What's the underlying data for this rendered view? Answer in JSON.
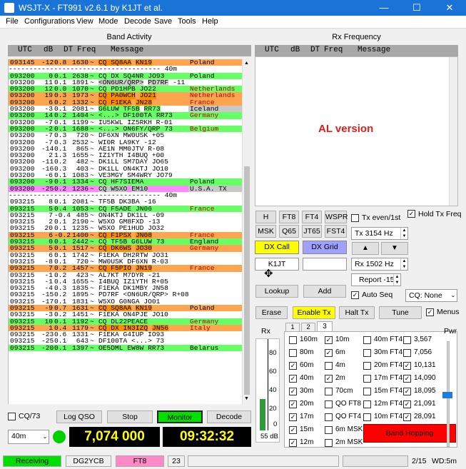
{
  "window": {
    "title": "WSJT-X - FT991  v2.6.1  by K1JT et al."
  },
  "menu": [
    "File",
    "Configurations",
    "View",
    "Mode",
    "Decode",
    "Save",
    "Tools",
    "Help"
  ],
  "band_activity": {
    "title": "Band Activity",
    "headers": [
      "UTC",
      "dB",
      "DT",
      "Freq",
      "Message"
    ],
    "rows": [
      {
        "u": "093145",
        "d": "-12",
        "t": "0.8",
        "f": "1630",
        "m": "CQ SQ8AA",
        "g": "KN19",
        "c": "Poland",
        "bg": "#ffa550",
        "hl": "#ff8c00",
        "cc": "#000"
      },
      {
        "sep": true,
        "text": "------------------------------------- 40m"
      },
      {
        "u": "093200",
        "d": "0",
        "t": "0.1",
        "f": "2638",
        "m": "CQ DX SQ4NR",
        "g": "JO93",
        "c": "Poland",
        "bg": "#66ff66",
        "hl": "#66ff66",
        "cc": "#000"
      },
      {
        "u": "093200",
        "d": "11",
        "t": "0.1",
        "f": "1891",
        "m": "<ON6UR/QRP>",
        "g": "PD7RF",
        "x": "-11",
        "bg": "#fff",
        "hl": "#d0d0d0",
        "cc": "#000"
      },
      {
        "u": "093200",
        "d": "12",
        "t": "0.0",
        "f": "1070",
        "m": "CQ PD1HPB",
        "g": "JO22",
        "c": "Netherlands",
        "bg": "#66ff66",
        "hl": "#66ff66",
        "cc": "#b00"
      },
      {
        "u": "093200",
        "d": "19",
        "t": "0.3",
        "f": "1973",
        "m": "CQ PA0WCH",
        "g": "JO21",
        "c": "Netherlands",
        "bg": "#ffa550",
        "hl": "#ff8c00",
        "cc": "#b00"
      },
      {
        "u": "093200",
        "d": "6",
        "t": "0.2",
        "f": "1332",
        "m": "CQ F1EKA",
        "g": "JN28",
        "c": "France",
        "bg": "#ffa550",
        "hl": "#ff8c00",
        "cc": "#b00"
      },
      {
        "u": "093200",
        "d": "-3",
        "t": "0.1",
        "f": "2081",
        "m": "G6LUW TF5B",
        "g": "RR73",
        "c": "Iceland",
        "bg": "#fff",
        "hl": "#66ff66",
        "cc": "#000",
        "cb": "#c8c8c8"
      },
      {
        "u": "093200",
        "d": "14",
        "t": "0.2",
        "f": "1404",
        "m": "<...> DF100TA",
        "g": "RR73",
        "c": "Germany",
        "bg": "#66ff66",
        "hl": "#66ff66",
        "cc": "#b00"
      },
      {
        "u": "093200",
        "d": "-7",
        "t": "0.1",
        "f": "1199",
        "m": "IU5KWL IZ5RKH R-01",
        "bg": "#fff"
      },
      {
        "u": "093200",
        "d": "-2",
        "t": "0.1",
        "f": "1688",
        "m": "<...> ON6FY/QRP",
        "g": "73",
        "c": "Belgium",
        "bg": "#66ff66",
        "hl": "#66ff66",
        "cc": "#b00"
      },
      {
        "u": "093200",
        "d": "-7",
        "t": "0.3",
        "f": "720",
        "m": "DF6XN MW0USK +05",
        "bg": "#fff"
      },
      {
        "u": "093200",
        "d": "-7",
        "t": "0.3",
        "f": "2532",
        "m": "WI0R LA9KY -12",
        "bg": "#fff"
      },
      {
        "u": "093200",
        "d": "-14",
        "t": "0.1",
        "f": "865",
        "m": "AE1N MM0JTV R-08",
        "bg": "#fff"
      },
      {
        "u": "093200",
        "d": "2",
        "t": "1.3",
        "f": "1655",
        "m": "IZ1YTH I4BUQ +00",
        "bg": "#fff"
      },
      {
        "u": "093200",
        "d": "-11",
        "t": "0.2",
        "f": "482",
        "m": "DK1LL SM7DAY JO65",
        "bg": "#fff"
      },
      {
        "u": "093200",
        "d": "-16",
        "t": "0.3",
        "f": "403",
        "m": "DK1LL ON4KTJ JO10",
        "bg": "#fff"
      },
      {
        "u": "093200",
        "d": "-6",
        "t": "0.1",
        "f": "1083",
        "m": "VE3MGY SM4WRY JO79",
        "bg": "#fff"
      },
      {
        "u": "093200",
        "d": "-9",
        "t": "0.1",
        "f": "1334",
        "m": "CQ HF7SIEMA",
        "c": "Poland",
        "bg": "#66ff66",
        "hl": "#66ff66",
        "cc": "#000"
      },
      {
        "u": "093200",
        "d": "-25",
        "t": "0.2",
        "f": "1236",
        "m": "CQ W5XO",
        "g": "EM10",
        "c": "U.S.A. TX",
        "bg": "#ff88ff",
        "hl": "#c8c8c8",
        "cc": "#000",
        "cb": "#c8c8c8"
      },
      {
        "sep": true,
        "text": "------------------------------------- 40m"
      },
      {
        "u": "093215",
        "d": "8",
        "t": "0.1",
        "f": "2081",
        "m": "TF5B DK3BA -16",
        "bg": "#fff"
      },
      {
        "u": "093215",
        "d": "5",
        "t": "0.4",
        "f": "1053",
        "m": "CQ F5ADE",
        "g": "JN06",
        "c": "France",
        "bg": "#66ff66",
        "hl": "#66ff66",
        "cc": "#b00"
      },
      {
        "u": "093215",
        "d": "7",
        "t": "-0.4",
        "f": "485",
        "m": "ON4KTJ DK1LL -09",
        "bg": "#fff"
      },
      {
        "u": "093215",
        "d": "2",
        "t": "0.1",
        "f": "2190",
        "m": "W5XO GM8FXD -13",
        "bg": "#fff"
      },
      {
        "u": "093215",
        "d": "20",
        "t": "0.1",
        "f": "1235",
        "m": "W5XO PE1HUD JO32",
        "bg": "#fff"
      },
      {
        "u": "093215",
        "d": "6",
        "t": "-0.2",
        "f": "1400",
        "m": "CQ F1PSX",
        "g": "JN08",
        "c": "France",
        "bg": "#ffa550",
        "hl": "#ff8c00",
        "cc": "#b00"
      },
      {
        "u": "093215",
        "d": "0",
        "t": "0.1",
        "f": "2442",
        "m": "CQ TF5B G6LUW",
        "g": "73",
        "c": "England",
        "bg": "#66ff66",
        "hl": "#66ff66",
        "cc": "#000"
      },
      {
        "u": "093215",
        "d": "5",
        "t": "0.1",
        "f": "1517",
        "m": "CQ DK6WS",
        "g": "JO30",
        "c": "Germany",
        "bg": "#ffa550",
        "hl": "#ff8c00",
        "cc": "#b00"
      },
      {
        "u": "093215",
        "d": "6",
        "t": "0.1",
        "f": "1742",
        "m": "F1EKA DH2RTW JO31",
        "bg": "#fff"
      },
      {
        "u": "093215",
        "d": "-8",
        "t": "0.1",
        "f": "720",
        "m": "MW0USK DF6XN R-03",
        "bg": "#fff"
      },
      {
        "u": "093215",
        "d": "7",
        "t": "0.2",
        "f": "1457",
        "m": "CQ F5PIO",
        "g": "JN19",
        "c": "France",
        "bg": "#ffa550",
        "hl": "#ff8c00",
        "cc": "#b00"
      },
      {
        "u": "093215",
        "d": "-1",
        "t": "0.2",
        "f": "423",
        "m": "AL7KT M7DYR -21",
        "bg": "#fff"
      },
      {
        "u": "093215",
        "d": "-1",
        "t": "0.4",
        "f": "1655",
        "m": "I4BUQ IZ1YTH R+05",
        "bg": "#fff"
      },
      {
        "u": "093215",
        "d": "-4",
        "t": "0.3",
        "f": "1835",
        "m": "F1EKA DK1MBY JN58",
        "bg": "#fff"
      },
      {
        "u": "093215",
        "d": "-15",
        "t": "0.2",
        "f": "1895",
        "m": "PD7RF <ON6UR/QRP> R+08",
        "bg": "#fff"
      },
      {
        "u": "093215",
        "d": "-17",
        "t": "0.1",
        "f": "1831",
        "m": "W5XO G0NGA JO01",
        "bg": "#fff"
      },
      {
        "u": "093215",
        "d": "-9",
        "t": "0.7",
        "f": "1631",
        "m": "CQ SQ8AA",
        "g": "KN19",
        "c": "Poland",
        "bg": "#ffa550",
        "hl": "#ff8c00",
        "cc": "#000"
      },
      {
        "u": "093215",
        "d": "-3",
        "t": "0.2",
        "f": "1451",
        "m": "F1EKA ON4PJE JO10",
        "bg": "#fff"
      },
      {
        "u": "093215",
        "d": "10",
        "t": "0.1",
        "f": "1192",
        "m": "CQ DL22PEACE",
        "c": "Germany",
        "bg": "#66ff66",
        "hl": "#66ff66",
        "cc": "#b00"
      },
      {
        "u": "093215",
        "d": "1",
        "t": "0.4",
        "f": "1179",
        "m": "CQ DX IN3IZQ",
        "g": "JN56",
        "c": "Italy",
        "bg": "#ffa550",
        "hl": "#ff8c00",
        "cc": "#b00"
      },
      {
        "u": "093215",
        "d": "-23",
        "t": "0.6",
        "f": "1331",
        "m": "F1EKA G4IUP IO93",
        "bg": "#fff"
      },
      {
        "u": "093215",
        "d": "-25",
        "t": "0.1",
        "f": "643",
        "m": "DF100TA <...> 73",
        "bg": "#fff"
      },
      {
        "u": "093215",
        "d": "-20",
        "t": "0.1",
        "f": "1397",
        "m": "OE5DML EW8W RR73",
        "c": "Belarus",
        "bg": "#66ff66",
        "hl": "#66ff66",
        "cc": "#000"
      }
    ]
  },
  "rx_frequency": {
    "title": "Rx Frequency",
    "headers": [
      "UTC",
      "dB",
      "DT",
      "Freq",
      "Message"
    ],
    "note": "AL version"
  },
  "controls": {
    "cq73": "CQ/73",
    "log_qso": "Log QSO",
    "stop": "Stop",
    "monitor": "Monitor",
    "decode": "Decode",
    "band": "40m",
    "freq": "7,074 000",
    "clock": "09:32:32"
  },
  "mode_buttons": [
    "H",
    "FT8",
    "FT4",
    "WSPR",
    "MSK",
    "Q65",
    "JT65",
    "FST4"
  ],
  "tx_even": "Tx even/1st",
  "hold_tx": "Hold Tx Freq",
  "tx_freq": "Tx  3154 Hz",
  "rx_freq": "Rx  1502 Hz",
  "report": "Report -15",
  "dx_call": "DX Call",
  "dx_grid": "DX Grid",
  "dx_call_value": "K1JT",
  "lookup": "Lookup",
  "add": "Add",
  "auto_seq": "Auto Seq",
  "cq_none": "CQ: None",
  "erase": "Erase",
  "enable_tx": "Enable Tx",
  "halt_tx": "Halt Tx",
  "tune": "Tune",
  "menus": "Menus",
  "meter": {
    "title": "Rx",
    "ticks": [
      "80",
      "60",
      "40",
      "20",
      "0"
    ],
    "value": "55 dB",
    "level_pct": 34
  },
  "pwr": "Pwr",
  "tabs": [
    "1",
    "2",
    "3"
  ],
  "bands_col1": [
    {
      "l": "160m",
      "c": false
    },
    {
      "l": "80m",
      "c": false
    },
    {
      "l": "60m",
      "c": true
    },
    {
      "l": "40m",
      "c": true
    },
    {
      "l": "30m",
      "c": true
    },
    {
      "l": "20m",
      "c": true
    },
    {
      "l": "17m",
      "c": true
    },
    {
      "l": "15m",
      "c": true
    },
    {
      "l": "12m",
      "c": true
    }
  ],
  "bands_col2": [
    {
      "l": "10m",
      "c": true
    },
    {
      "l": "6m",
      "c": true
    },
    {
      "l": "4m",
      "c": false
    },
    {
      "l": "2m",
      "c": true
    },
    {
      "l": "70cm",
      "c": false
    },
    {
      "l": "QO FT8",
      "c": false
    },
    {
      "l": "QO FT4",
      "c": false
    },
    {
      "l": "6m MSK",
      "c": false
    },
    {
      "l": "2m MSK",
      "c": false
    }
  ],
  "bands_col3": [
    {
      "l": "40m FT4",
      "c": false
    },
    {
      "l": "30m FT4",
      "c": false
    },
    {
      "l": "20m FT4",
      "c": false
    },
    {
      "l": "17m FT4",
      "c": false
    },
    {
      "l": "15m FT4",
      "c": false
    },
    {
      "l": "12m FT4",
      "c": false
    },
    {
      "l": "10m FT4",
      "c": false
    }
  ],
  "bands_col4": [
    {
      "l": "3,567",
      "c": false
    },
    {
      "l": "7,056",
      "c": false
    },
    {
      "l": "10,131",
      "c": true
    },
    {
      "l": "14,090",
      "c": true
    },
    {
      "l": "18,095",
      "c": true
    },
    {
      "l": "21,091",
      "c": true
    },
    {
      "l": "28,091",
      "c": true
    }
  ],
  "band_hopping": "Band Hopping",
  "status": {
    "receiving": "Receiving",
    "call": "DG2YCB",
    "mode": "FT8",
    "num": "23",
    "page": "2/15",
    "wd": "WD:5m"
  }
}
